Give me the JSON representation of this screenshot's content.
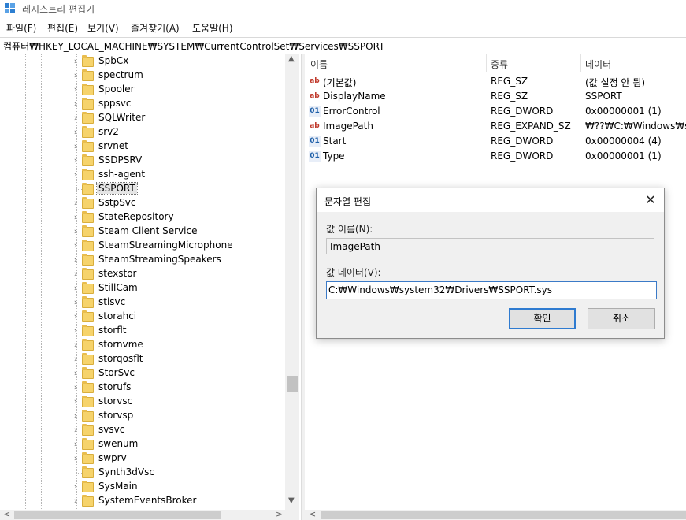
{
  "window": {
    "title": "레지스트리 편집기"
  },
  "menu": [
    "파일(F)",
    "편집(E)",
    "보기(V)",
    "즐겨찾기(A)",
    "도움말(H)"
  ],
  "address": "컴퓨터₩HKEY_LOCAL_MACHINE₩SYSTEM₩CurrentControlSet₩Services₩SSPORT",
  "tree": {
    "items": [
      {
        "label": "SpbCx",
        "expandable": true
      },
      {
        "label": "spectrum",
        "expandable": true
      },
      {
        "label": "Spooler",
        "expandable": true
      },
      {
        "label": "sppsvc",
        "expandable": true
      },
      {
        "label": "SQLWriter",
        "expandable": true
      },
      {
        "label": "srv2",
        "expandable": true
      },
      {
        "label": "srvnet",
        "expandable": true
      },
      {
        "label": "SSDPSRV",
        "expandable": true
      },
      {
        "label": "ssh-agent",
        "expandable": true
      },
      {
        "label": "SSPORT",
        "expandable": false,
        "selected": true
      },
      {
        "label": "SstpSvc",
        "expandable": true
      },
      {
        "label": "StateRepository",
        "expandable": true
      },
      {
        "label": "Steam Client Service",
        "expandable": true
      },
      {
        "label": "SteamStreamingMicrophone",
        "expandable": true
      },
      {
        "label": "SteamStreamingSpeakers",
        "expandable": true
      },
      {
        "label": "stexstor",
        "expandable": true
      },
      {
        "label": "StillCam",
        "expandable": true
      },
      {
        "label": "stisvc",
        "expandable": true
      },
      {
        "label": "storahci",
        "expandable": true
      },
      {
        "label": "storflt",
        "expandable": true
      },
      {
        "label": "stornvme",
        "expandable": true
      },
      {
        "label": "storqosflt",
        "expandable": true
      },
      {
        "label": "StorSvc",
        "expandable": true
      },
      {
        "label": "storufs",
        "expandable": true
      },
      {
        "label": "storvsc",
        "expandable": true
      },
      {
        "label": "storvsp",
        "expandable": true
      },
      {
        "label": "svsvc",
        "expandable": true
      },
      {
        "label": "swenum",
        "expandable": true
      },
      {
        "label": "swprv",
        "expandable": true
      },
      {
        "label": "Synth3dVsc",
        "expandable": false
      },
      {
        "label": "SysMain",
        "expandable": true
      },
      {
        "label": "SystemEventsBroker",
        "expandable": true
      }
    ]
  },
  "list": {
    "columns": [
      "이름",
      "종류",
      "데이터"
    ],
    "rows": [
      {
        "icon": "string-value-icon",
        "name": "(기본값)",
        "type": "REG_SZ",
        "data": "(값 설정 안 됨)"
      },
      {
        "icon": "string-value-icon",
        "name": "DisplayName",
        "type": "REG_SZ",
        "data": "SSPORT"
      },
      {
        "icon": "binary-value-icon",
        "name": "ErrorControl",
        "type": "REG_DWORD",
        "data": "0x00000001 (1)"
      },
      {
        "icon": "string-value-icon",
        "name": "ImagePath",
        "type": "REG_EXPAND_SZ",
        "data": "₩??₩C:₩Windows₩syst"
      },
      {
        "icon": "binary-value-icon",
        "name": "Start",
        "type": "REG_DWORD",
        "data": "0x00000004 (4)"
      },
      {
        "icon": "binary-value-icon",
        "name": "Type",
        "type": "REG_DWORD",
        "data": "0x00000001 (1)"
      }
    ]
  },
  "dialog": {
    "title": "문자열 편집",
    "name_label": "값 이름(N):",
    "name_value": "ImagePath",
    "data_label": "값 데이터(V):",
    "data_value": "C:₩Windows₩system32₩Drivers₩SSPORT.sys",
    "ok_label": "확인",
    "cancel_label": "취소"
  }
}
